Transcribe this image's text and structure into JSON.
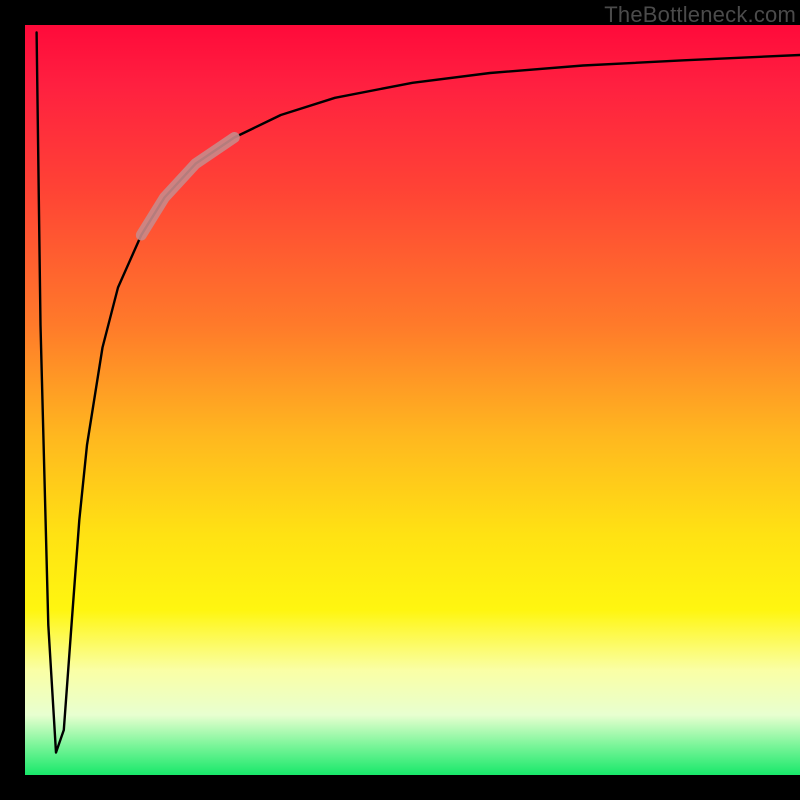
{
  "attribution": "TheBottleneck.com",
  "chart_data": {
    "type": "line",
    "title": "",
    "xlabel": "",
    "ylabel": "",
    "xlim": [
      0,
      100
    ],
    "ylim": [
      0,
      100
    ],
    "grid": false,
    "legend": false,
    "annotations": [],
    "series": [
      {
        "name": "bottleneck-curve",
        "color": "#000000",
        "x": [
          1.5,
          2.0,
          3.0,
          4.0,
          5.0,
          6.0,
          7.0,
          8.0,
          10.0,
          12.0,
          15.0,
          18.0,
          22.0,
          27.0,
          33.0,
          40.0,
          50.0,
          60.0,
          72.0,
          85.0,
          100.0
        ],
        "y": [
          99.0,
          60.0,
          20.0,
          3.0,
          6.0,
          20.0,
          34.0,
          44.0,
          57.0,
          65.0,
          72.0,
          77.0,
          81.5,
          85.0,
          88.0,
          90.3,
          92.3,
          93.6,
          94.6,
          95.3,
          96.0
        ]
      },
      {
        "name": "highlight-segment",
        "color": "#c98a8a",
        "x": [
          15.0,
          18.0,
          22.0,
          27.0
        ],
        "y": [
          72.0,
          77.0,
          81.5,
          85.0
        ]
      }
    ],
    "background_gradient": {
      "direction": "vertical",
      "stops": [
        {
          "pos": 0.0,
          "color": "#ff0a3a"
        },
        {
          "pos": 0.4,
          "color": "#ff7a2a"
        },
        {
          "pos": 0.68,
          "color": "#ffe213"
        },
        {
          "pos": 0.86,
          "color": "#faffa5"
        },
        {
          "pos": 1.0,
          "color": "#18e86a"
        }
      ]
    }
  }
}
